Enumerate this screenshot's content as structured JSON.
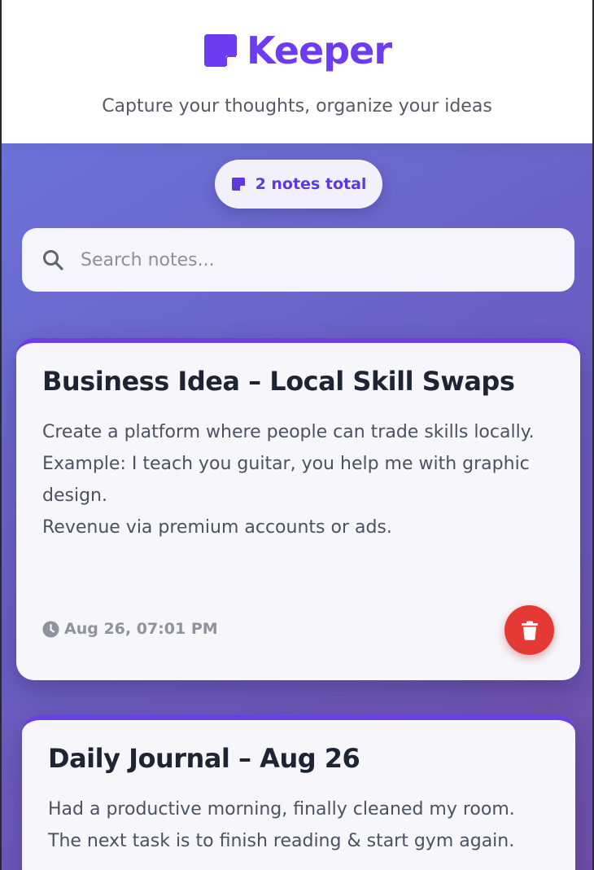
{
  "header": {
    "app_name": "Keeper",
    "tagline": "Capture your thoughts, organize your ideas",
    "brand_icon": "sticky-note-icon",
    "brand_color": "#6d3cf0"
  },
  "stats": {
    "count_label": "2 notes total",
    "icon": "sticky-note-icon"
  },
  "search": {
    "placeholder": "Search notes...",
    "value": "",
    "icon": "search-icon"
  },
  "notes": [
    {
      "title": "Business Idea – Local Skill Swaps",
      "body": "Create a platform where people can trade skills locally.\nExample: I teach you guitar, you help me with graphic design.\nRevenue via premium accounts or ads.",
      "timestamp": "Aug 26, 07:01 PM",
      "time_icon": "clock-icon",
      "delete_icon": "trash-icon"
    },
    {
      "title": "Daily Journal – Aug 26",
      "body": "Had a productive morning, finally cleaned my room.\nThe next task is to finish reading & start gym again."
    }
  ],
  "colors": {
    "accent": "#6c3fe6",
    "delete": "#e53935",
    "background_start": "#6b72d9",
    "background_end": "#6f4ea8"
  }
}
